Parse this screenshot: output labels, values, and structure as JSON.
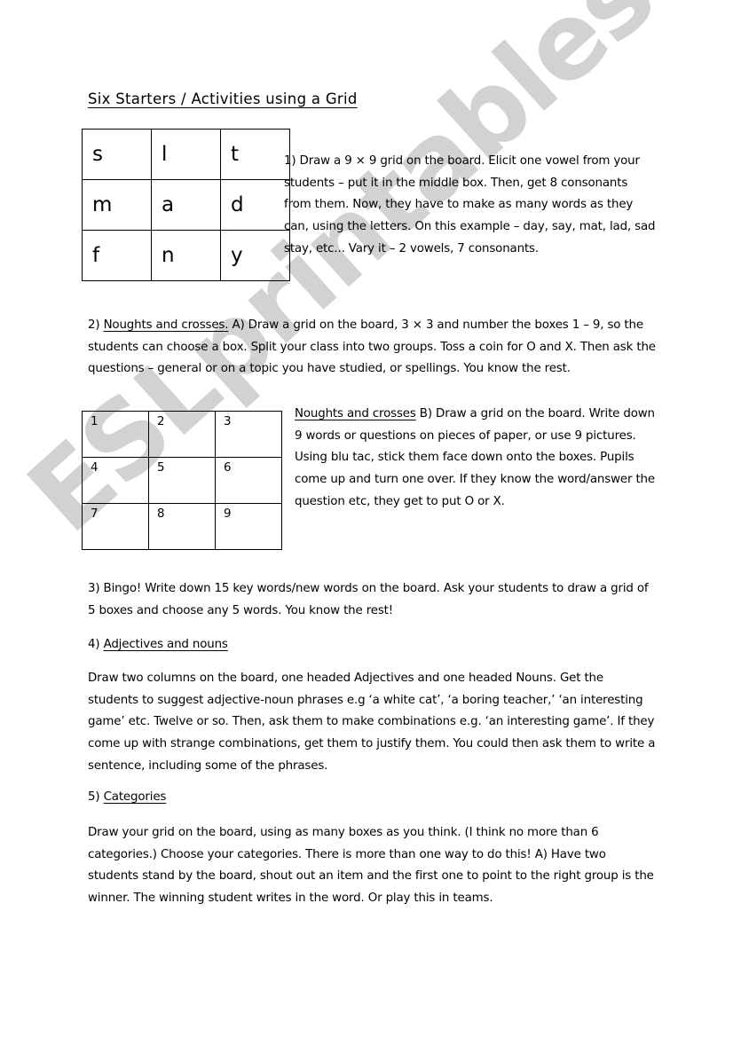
{
  "document": {
    "title": "Six Starters / Activities using a Grid",
    "watermark": "ESLprintables.com",
    "watermark_color": "#d2d2d2",
    "page_background": "#ffffff",
    "text_color": "#000000"
  },
  "letter_grid": {
    "name": "letters-grid",
    "rows": [
      [
        "s",
        "l",
        "t"
      ],
      [
        "m",
        "a",
        "d"
      ],
      [
        "f",
        "n",
        "y"
      ]
    ]
  },
  "number_grid": {
    "name": "numbers-grid",
    "rows": [
      [
        "1",
        "2",
        "3"
      ],
      [
        "4",
        "5",
        "6"
      ],
      [
        "7",
        "8",
        "9"
      ]
    ]
  },
  "activities": {
    "item1": "1) Draw a 9 × 9 grid on the board. Elicit one vowel from your students – put it in the middle box. Then, get 8 consonants from them. Now, they have to make as many words as they can, using the letters. On this example – day, say, mat, lad, sad stay, etc... Vary it – 2 vowels, 7 consonants.",
    "item2_number": "2)",
    "item2_heading": "Noughts and crosses.",
    "item2_body": " A) Draw a grid on the board, 3 × 3 and number the boxes 1 – 9, so the students can choose a box. Split your class into two groups. Toss a coin for O and X. Then ask the questions – general or on a topic you have studied, or spellings. You know the rest.",
    "item2b_heading": "Noughts and crosses",
    "item2b_body": " B) Draw a grid on the board. Write down 9 words or questions on pieces of paper, or use 9 pictures. Using blu tac, stick them face down onto the boxes. Pupils come up and turn one over. If they know the word/answer the question etc, they get to put O or X.",
    "item3": "3) Bingo! Write down 15 key words/new words on the board. Ask your students to draw a grid of 5 boxes and choose any 5 words. You know the rest!",
    "item4_number": "4)",
    "item4_heading": "Adjectives and nouns",
    "item4_body": "Draw two columns on the board, one headed Adjectives and one headed Nouns. Get the students to suggest adjective-noun phrases e.g ‘a white cat’, ‘a boring teacher,’ ‘an interesting game’ etc. Twelve or so. Then, ask them to make combinations e.g. ‘an interesting game’. If they come up with strange combinations, get them to justify them. You could then ask them to write a sentence, including some of the phrases.",
    "item5_number": "5)",
    "item5_heading": "Categories",
    "item5_body": "Draw your grid on the board, using as many boxes as you think. (I think no more than 6 categories.)  Choose your categories. There is more than one way to do this!  A)  Have two students stand by the board, shout out an item and the first one to point to the right group is the winner. The winning student writes in the word. Or play this in teams."
  }
}
